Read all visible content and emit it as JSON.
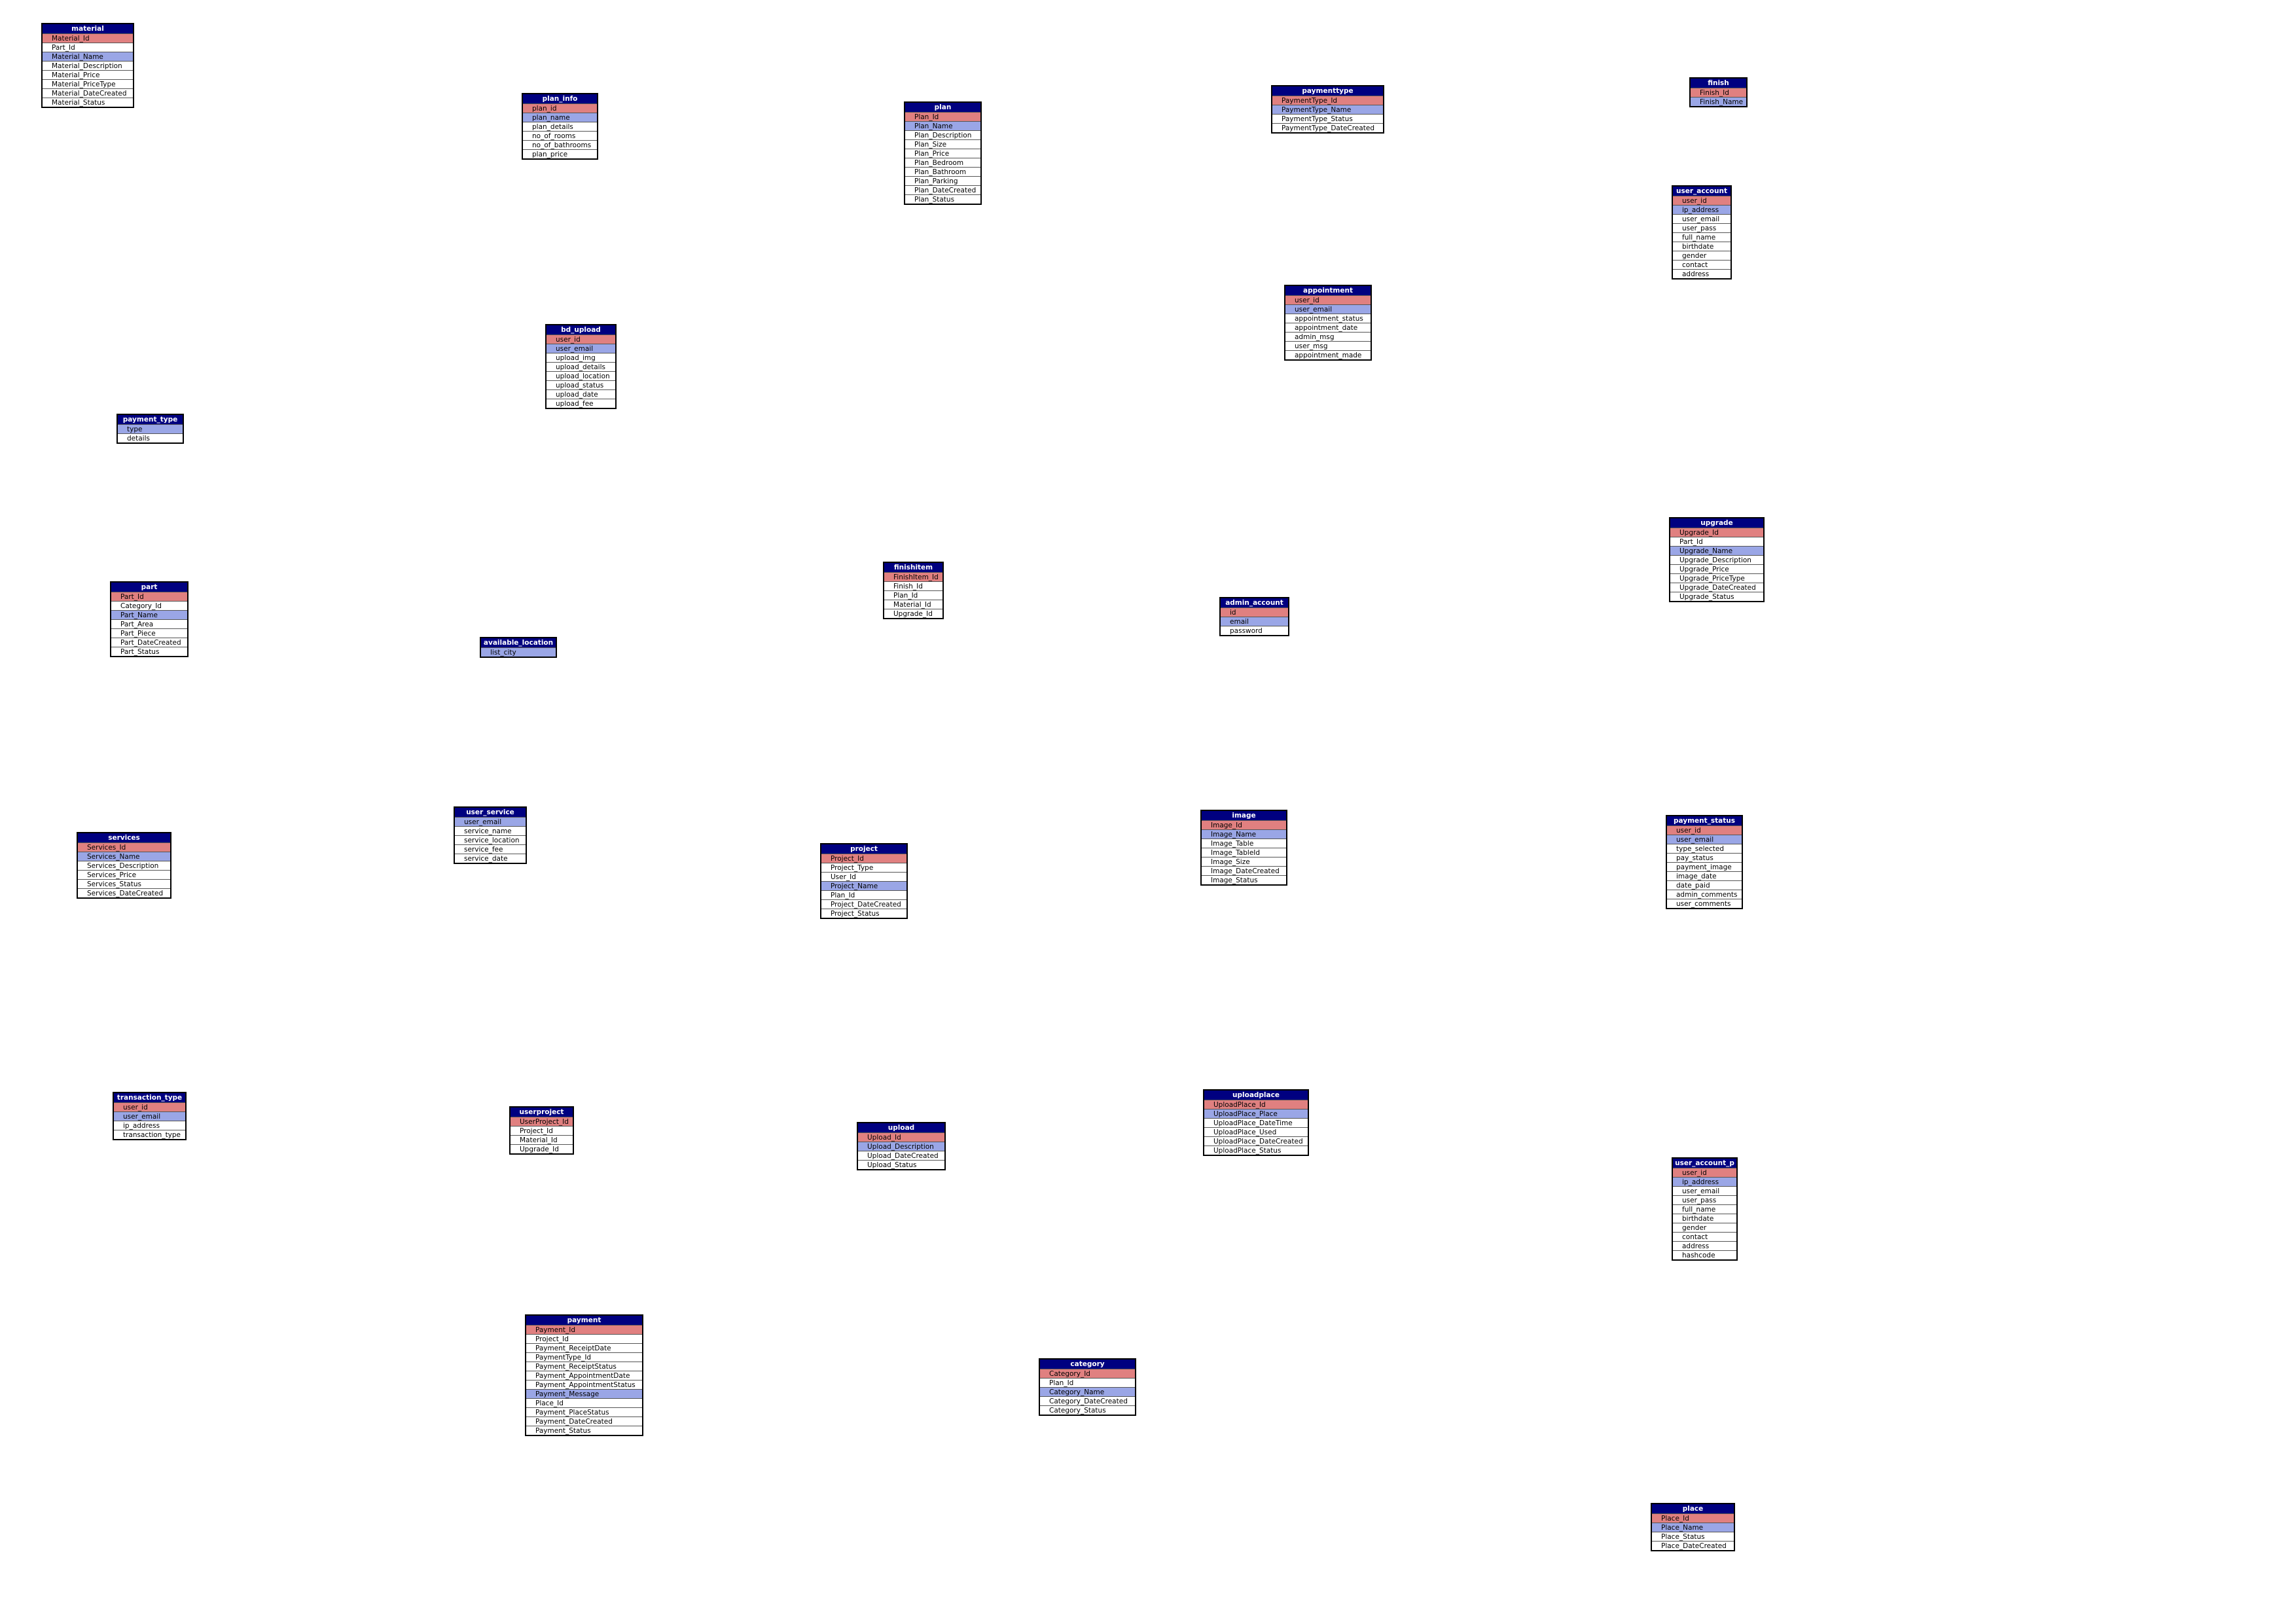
{
  "tables": [
    {
      "name": "material",
      "fields": [
        {
          "n": "Material_Id",
          "k": "pk"
        },
        {
          "n": "Part_Id"
        },
        {
          "n": "Material_Name",
          "k": "ix"
        },
        {
          "n": "Material_Description"
        },
        {
          "n": "Material_Price"
        },
        {
          "n": "Material_PriceType"
        },
        {
          "n": "Material_DateCreated"
        },
        {
          "n": "Material_Status"
        }
      ]
    },
    {
      "name": "plan_info",
      "fields": [
        {
          "n": "plan_id",
          "k": "pk"
        },
        {
          "n": "plan_name",
          "k": "ix"
        },
        {
          "n": "plan_details"
        },
        {
          "n": "no_of_rooms"
        },
        {
          "n": "no_of_bathrooms"
        },
        {
          "n": "plan_price"
        }
      ]
    },
    {
      "name": "plan",
      "fields": [
        {
          "n": "Plan_Id",
          "k": "pk"
        },
        {
          "n": "Plan_Name",
          "k": "ix"
        },
        {
          "n": "Plan_Description"
        },
        {
          "n": "Plan_Size"
        },
        {
          "n": "Plan_Price"
        },
        {
          "n": "Plan_Bedroom"
        },
        {
          "n": "Plan_Bathroom"
        },
        {
          "n": "Plan_Parking"
        },
        {
          "n": "Plan_DateCreated"
        },
        {
          "n": "Plan_Status"
        }
      ]
    },
    {
      "name": "paymenttype",
      "fields": [
        {
          "n": "PaymentType_Id",
          "k": "pk"
        },
        {
          "n": "PaymentType_Name",
          "k": "ix"
        },
        {
          "n": "PaymentType_Status"
        },
        {
          "n": "PaymentType_DateCreated"
        }
      ]
    },
    {
      "name": "finish",
      "fields": [
        {
          "n": "Finish_Id",
          "k": "pk"
        },
        {
          "n": "Finish_Name",
          "k": "ix"
        }
      ]
    },
    {
      "name": "user_account",
      "fields": [
        {
          "n": "user_id",
          "k": "pk"
        },
        {
          "n": "ip_address",
          "k": "ix"
        },
        {
          "n": "user_email"
        },
        {
          "n": "user_pass"
        },
        {
          "n": "full_name"
        },
        {
          "n": "birthdate"
        },
        {
          "n": "gender"
        },
        {
          "n": "contact"
        },
        {
          "n": "address"
        }
      ]
    },
    {
      "name": "appointment",
      "fields": [
        {
          "n": "user_id",
          "k": "pk"
        },
        {
          "n": "user_email",
          "k": "ix"
        },
        {
          "n": "appointment_status"
        },
        {
          "n": "appointment_date"
        },
        {
          "n": "admin_msg"
        },
        {
          "n": "user_msg"
        },
        {
          "n": "appointment_made"
        }
      ]
    },
    {
      "name": "bd_upload",
      "fields": [
        {
          "n": "user_id",
          "k": "pk"
        },
        {
          "n": "user_email",
          "k": "ix"
        },
        {
          "n": "upload_img"
        },
        {
          "n": "upload_details"
        },
        {
          "n": "upload_location"
        },
        {
          "n": "upload_status"
        },
        {
          "n": "upload_date"
        },
        {
          "n": "upload_fee"
        }
      ]
    },
    {
      "name": "payment_type",
      "fields": [
        {
          "n": "type",
          "k": "ix"
        },
        {
          "n": "details"
        }
      ]
    },
    {
      "name": "upgrade",
      "fields": [
        {
          "n": "Upgrade_Id",
          "k": "pk"
        },
        {
          "n": "Part_Id"
        },
        {
          "n": "Upgrade_Name",
          "k": "ix"
        },
        {
          "n": "Upgrade_Description"
        },
        {
          "n": "Upgrade_Price"
        },
        {
          "n": "Upgrade_PriceType"
        },
        {
          "n": "Upgrade_DateCreated"
        },
        {
          "n": "Upgrade_Status"
        }
      ]
    },
    {
      "name": "part",
      "fields": [
        {
          "n": "Part_Id",
          "k": "pk"
        },
        {
          "n": "Category_Id"
        },
        {
          "n": "Part_Name",
          "k": "ix"
        },
        {
          "n": "Part_Area"
        },
        {
          "n": "Part_Piece"
        },
        {
          "n": "Part_DateCreated"
        },
        {
          "n": "Part_Status"
        }
      ]
    },
    {
      "name": "finishitem",
      "fields": [
        {
          "n": "FinishItem_Id",
          "k": "pk"
        },
        {
          "n": "Finish_Id"
        },
        {
          "n": "Plan_Id"
        },
        {
          "n": "Material_Id"
        },
        {
          "n": "Upgrade_Id"
        }
      ]
    },
    {
      "name": "admin_account",
      "fields": [
        {
          "n": "id",
          "k": "pk"
        },
        {
          "n": "email",
          "k": "ix"
        },
        {
          "n": "password"
        }
      ]
    },
    {
      "name": "available_location",
      "fields": [
        {
          "n": "list_city",
          "k": "ix"
        }
      ]
    },
    {
      "name": "services",
      "fields": [
        {
          "n": "Services_Id",
          "k": "pk"
        },
        {
          "n": "Services_Name",
          "k": "ix"
        },
        {
          "n": "Services_Description"
        },
        {
          "n": "Services_Price"
        },
        {
          "n": "Services_Status"
        },
        {
          "n": "Services_DateCreated"
        }
      ]
    },
    {
      "name": "user_service",
      "fields": [
        {
          "n": "user_email",
          "k": "ix"
        },
        {
          "n": "service_name"
        },
        {
          "n": "service_location"
        },
        {
          "n": "service_fee"
        },
        {
          "n": "service_date"
        }
      ]
    },
    {
      "name": "project",
      "fields": [
        {
          "n": "Project_Id",
          "k": "pk"
        },
        {
          "n": "Project_Type"
        },
        {
          "n": "User_Id"
        },
        {
          "n": "Project_Name",
          "k": "ix"
        },
        {
          "n": "Plan_Id"
        },
        {
          "n": "Project_DateCreated"
        },
        {
          "n": "Project_Status"
        }
      ]
    },
    {
      "name": "image",
      "fields": [
        {
          "n": "Image_Id",
          "k": "pk"
        },
        {
          "n": "Image_Name",
          "k": "ix"
        },
        {
          "n": "Image_Table"
        },
        {
          "n": "Image_TableId"
        },
        {
          "n": "Image_Size"
        },
        {
          "n": "Image_DateCreated"
        },
        {
          "n": "Image_Status"
        }
      ]
    },
    {
      "name": "payment_status",
      "fields": [
        {
          "n": "user_id",
          "k": "pk"
        },
        {
          "n": "user_email",
          "k": "ix"
        },
        {
          "n": "type_selected"
        },
        {
          "n": "pay_status"
        },
        {
          "n": "payment_image"
        },
        {
          "n": "image_date"
        },
        {
          "n": "date_paid"
        },
        {
          "n": "admin_comments"
        },
        {
          "n": "user_comments"
        }
      ]
    },
    {
      "name": "transaction_type",
      "fields": [
        {
          "n": "user_id",
          "k": "pk"
        },
        {
          "n": "user_email",
          "k": "ix"
        },
        {
          "n": "ip_address"
        },
        {
          "n": "transaction_type"
        }
      ]
    },
    {
      "name": "userproject",
      "fields": [
        {
          "n": "UserProject_Id",
          "k": "pk"
        },
        {
          "n": "Project_Id"
        },
        {
          "n": "Material_Id"
        },
        {
          "n": "Upgrade_Id"
        }
      ]
    },
    {
      "name": "upload",
      "fields": [
        {
          "n": "Upload_Id",
          "k": "pk"
        },
        {
          "n": "Upload_Description",
          "k": "ix"
        },
        {
          "n": "Upload_DateCreated"
        },
        {
          "n": "Upload_Status"
        }
      ]
    },
    {
      "name": "uploadplace",
      "fields": [
        {
          "n": "UploadPlace_Id",
          "k": "pk"
        },
        {
          "n": "UploadPlace_Place",
          "k": "ix"
        },
        {
          "n": "UploadPlace_DateTime"
        },
        {
          "n": "UploadPlace_Used"
        },
        {
          "n": "UploadPlace_DateCreated"
        },
        {
          "n": "UploadPlace_Status"
        }
      ]
    },
    {
      "name": "user_account_p",
      "fields": [
        {
          "n": "user_id",
          "k": "pk"
        },
        {
          "n": "ip_address",
          "k": "ix"
        },
        {
          "n": "user_email"
        },
        {
          "n": "user_pass"
        },
        {
          "n": "full_name"
        },
        {
          "n": "birthdate"
        },
        {
          "n": "gender"
        },
        {
          "n": "contact"
        },
        {
          "n": "address"
        },
        {
          "n": "hashcode"
        }
      ]
    },
    {
      "name": "payment",
      "fields": [
        {
          "n": "Payment_Id",
          "k": "pk"
        },
        {
          "n": "Project_Id"
        },
        {
          "n": "Payment_ReceiptDate"
        },
        {
          "n": "PaymentType_Id"
        },
        {
          "n": "Payment_ReceiptStatus"
        },
        {
          "n": "Payment_AppointmentDate"
        },
        {
          "n": "Payment_AppointmentStatus"
        },
        {
          "n": "Payment_Message",
          "k": "ix"
        },
        {
          "n": "Place_Id"
        },
        {
          "n": "Payment_PlaceStatus"
        },
        {
          "n": "Payment_DateCreated"
        },
        {
          "n": "Payment_Status"
        }
      ]
    },
    {
      "name": "category",
      "fields": [
        {
          "n": "Category_Id",
          "k": "pk"
        },
        {
          "n": "Plan_Id"
        },
        {
          "n": "Category_Name",
          "k": "ix"
        },
        {
          "n": "Category_DateCreated"
        },
        {
          "n": "Category_Status"
        }
      ]
    },
    {
      "name": "place",
      "fields": [
        {
          "n": "Place_Id",
          "k": "pk"
        },
        {
          "n": "Place_Name",
          "k": "ix"
        },
        {
          "n": "Place_Status"
        },
        {
          "n": "Place_DateCreated"
        }
      ]
    }
  ]
}
